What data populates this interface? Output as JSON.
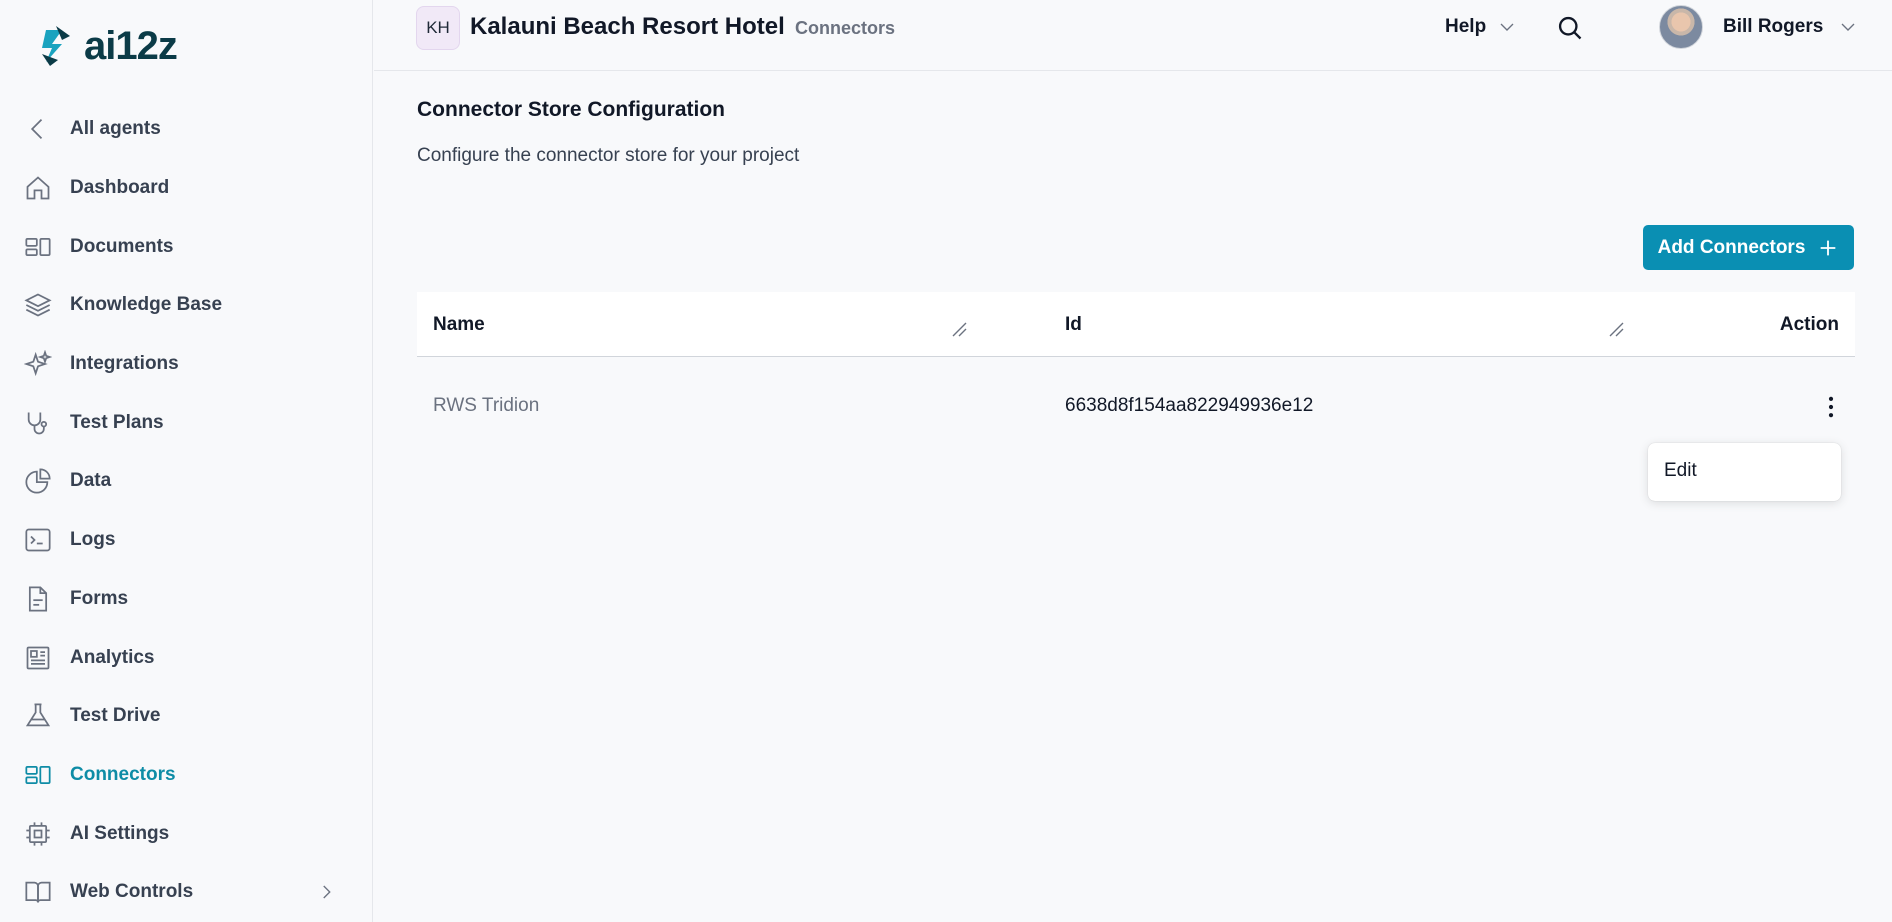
{
  "brand": {
    "logo_text": "ai12z",
    "accent": "#0e8ca6"
  },
  "sidebar": {
    "items": [
      {
        "label": "All agents",
        "icon": "chevron-left-icon"
      },
      {
        "label": "Dashboard",
        "icon": "home-icon"
      },
      {
        "label": "Documents",
        "icon": "documents-icon"
      },
      {
        "label": "Knowledge Base",
        "icon": "layers-icon"
      },
      {
        "label": "Integrations",
        "icon": "sparkles-icon"
      },
      {
        "label": "Test Plans",
        "icon": "stethoscope-icon"
      },
      {
        "label": "Data",
        "icon": "pie-chart-icon"
      },
      {
        "label": "Logs",
        "icon": "terminal-icon"
      },
      {
        "label": "Forms",
        "icon": "form-icon"
      },
      {
        "label": "Analytics",
        "icon": "newspaper-icon"
      },
      {
        "label": "Test Drive",
        "icon": "flask-icon"
      },
      {
        "label": "Connectors",
        "icon": "connectors-icon",
        "active": true
      },
      {
        "label": "AI Settings",
        "icon": "chip-icon"
      },
      {
        "label": "Web Controls",
        "icon": "book-icon"
      }
    ]
  },
  "header": {
    "org_initials": "KH",
    "org_name": "Kalauni Beach Resort Hotel",
    "crumb": "Connectors",
    "help": "Help",
    "user_name": "Bill Rogers"
  },
  "main": {
    "title": "Connector Store Configuration",
    "subtitle": "Configure the connector store for your project",
    "add_button": "Add Connectors",
    "table": {
      "columns": [
        "Name",
        "Id",
        "Action"
      ],
      "rows": [
        {
          "name": "RWS Tridion",
          "id": "6638d8f154aa822949936e12"
        }
      ]
    },
    "menu": {
      "edit": "Edit"
    }
  }
}
